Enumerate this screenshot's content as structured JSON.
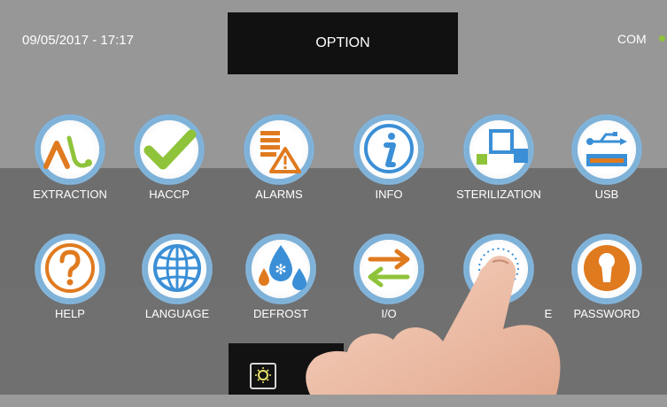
{
  "header": {
    "datetime": "09/05/2017 - 17:17",
    "title": "OPTION",
    "status": "COM",
    "status_color": "#8fc33a"
  },
  "row1": [
    {
      "label": "EXTRACTION",
      "icon": "extraction-icon"
    },
    {
      "label": "HACCP",
      "icon": "checkmark-icon"
    },
    {
      "label": "ALARMS",
      "icon": "alarm-icon"
    },
    {
      "label": "INFO",
      "icon": "info-icon"
    },
    {
      "label": "STERILIZATION",
      "icon": "sterilization-icon"
    },
    {
      "label": "USB",
      "icon": "usb-icon"
    }
  ],
  "row2": [
    {
      "label": "HELP",
      "icon": "question-icon"
    },
    {
      "label": "LANGUAGE",
      "icon": "globe-icon"
    },
    {
      "label": "DEFROST",
      "icon": "defrost-icon"
    },
    {
      "label": "I/O",
      "icon": "arrows-icon"
    },
    {
      "label": "E",
      "icon": "dial-icon"
    },
    {
      "label": "PASSWORD",
      "icon": "keyhole-icon"
    }
  ],
  "colors": {
    "accent_orange": "#e07a1f",
    "accent_blue": "#3b8fd6",
    "accent_green": "#8fc33a"
  },
  "bottom": {
    "icon": "brightness-icon"
  }
}
